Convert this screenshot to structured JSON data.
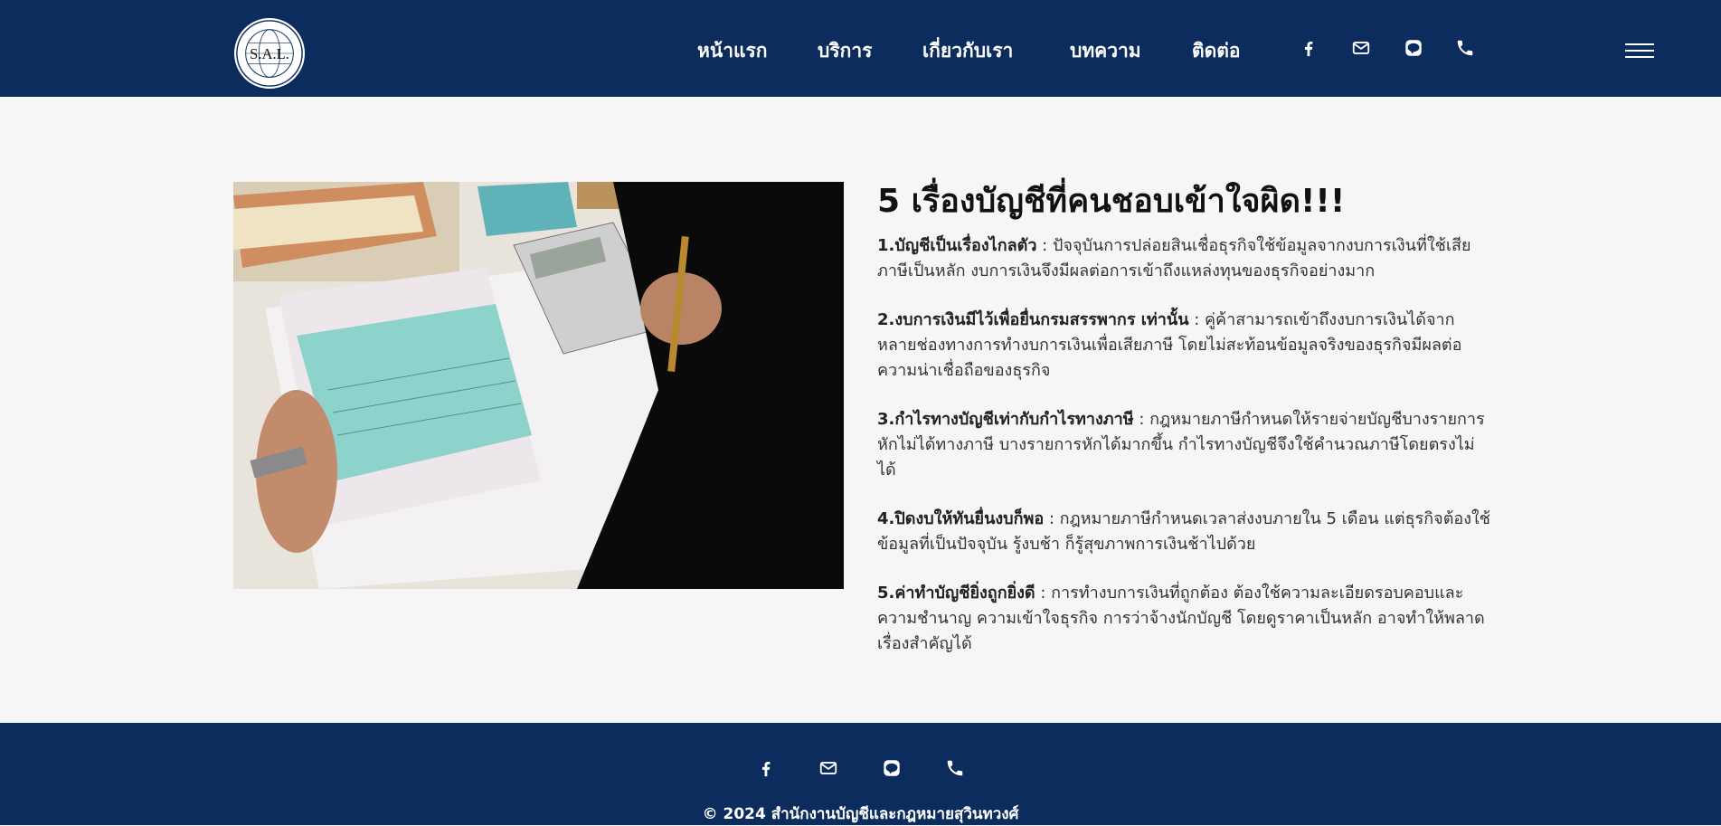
{
  "header": {
    "logo_text": "S.A.L.",
    "nav": [
      "หน้าแรก",
      "บริการ",
      "เกี่ยวกับเรา",
      "บทความ",
      "ติดต่อ"
    ],
    "icons": [
      "facebook-icon",
      "email-icon",
      "line-icon",
      "phone-icon",
      "hamburger-menu-icon"
    ]
  },
  "article": {
    "title": "5 เรื่องบัญชีที่คนชอบเข้าใจผิด!!!",
    "items": [
      {
        "heading": "1.บัญชีเป็นเรื่องไกลตัว",
        "text": " : ปัจจุบันการปล่อยสินเชื่อธุรกิจใช้ข้อมูลจากงบการเงินที่ใช้เสียภาษีเป็นหลัก งบการเงินจึงมีผลต่อการเข้าถึงแหล่งทุนของธุรกิจอย่างมาก"
      },
      {
        "heading": "2.งบการเงินมีไว้เพื่อยื่นกรมสรรพากร เท่านั้น",
        "text": " : คู่ค้าสามารถเข้าถึงงบการเงินได้จากหลายช่องทางการทำงบการเงินเพื่อเสียภาษี โดยไม่สะท้อนข้อมูลจริงของธุรกิจมีผลต่อความน่าเชื่อถือของธุรกิจ"
      },
      {
        "heading": "3.กำไรทางบัญชีเท่ากับกำไรทางภาษี",
        "text": " : กฎหมายภาษีกำหนดให้รายจ่ายบัญชีบางรายการหักไม่ได้ทางภาษี บางรายการหักได้มากขึ้น กำไรทางบัญชีจึงใช้คำนวณภาษีโดยตรงไม่ได้"
      },
      {
        "heading": "4.ปิดงบให้ทันยื่นงบก็พอ",
        "text": " : กฎหมายภาษีกำหนดเวลาส่งงบภายใน 5 เดือน แต่ธุรกิจต้องใช้ข้อมูลที่เป็นปัจจุบัน รู้งบช้า ก็รู้สุขภาพการเงินช้าไปด้วย"
      },
      {
        "heading": "5.ค่าทำบัญชียิ่งถูกยิ่งดี",
        "text": " : การทำงบการเงินที่ถูกต้อง ต้องใช้ความละเอียดรอบคอบและความชำนาญ ความเข้าใจธุรกิจ การว่าจ้างนักบัญชี โดยดูราคาเป็นหลัก อาจทำให้พลาดเรื่องสำคัญได้"
      }
    ]
  },
  "footer": {
    "icons": [
      "facebook-icon",
      "email-icon",
      "line-icon",
      "phone-icon"
    ],
    "copyright": "© 2024 สำนักงานบัญชีและกฎหมายสุวินทวงศ์"
  },
  "colors": {
    "brand_navy": "#0b2c5c",
    "background": "#f6f6f6"
  }
}
